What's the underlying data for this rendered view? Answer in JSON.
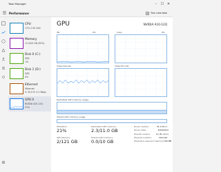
{
  "window": {
    "title": "Task Manager"
  },
  "header": {
    "section": "Performance",
    "run_new_task": "Run new task"
  },
  "sidebar": {
    "items": [
      {
        "name": "CPU",
        "sub1": "17%  2.50 GHz",
        "sub2": "",
        "color": "#117dbb"
      },
      {
        "name": "Memory",
        "sub1": "11.0/20 GB (55%)",
        "sub2": "",
        "color": "#8b12ae"
      },
      {
        "name": "Disk 0 (C:)",
        "sub1": "SSD",
        "sub2": "1%",
        "color": "#4da60c"
      },
      {
        "name": "Disk 1 (D:)",
        "sub1": "SSD",
        "sub2": "0%",
        "color": "#4da60c"
      },
      {
        "name": "Ethernet",
        "sub1": "Ethernet",
        "sub2": "S: 32.0  R: 0.1 Mbps",
        "color": "#a74f01"
      },
      {
        "name": "GPU 0",
        "sub1": "NVIDIA A10-12Q",
        "sub2": "21%",
        "color": "#1473e6"
      }
    ]
  },
  "main": {
    "title": "GPU",
    "model": "NVIDIA A10-12Q",
    "graphs": {
      "g1_left": "3D",
      "g1_right": "Copy",
      "g2_left": "Video Decode",
      "g2_right": "Video Encode",
      "dedicated": "Dedicated GPU memory usage",
      "shared": "Shared GPU memory usage",
      "g1_pct": "0%",
      "g1r_pct": "0%"
    },
    "stats": {
      "utilization_label": "Utilization",
      "utilization": "21%",
      "dedicated_label": "Dedicated GPU memory",
      "dedicated": "2.3/11.0 GB",
      "gpu_mem_label": "GPU Memory",
      "gpu_mem": "2/121 GB",
      "shared_label": "Shared GPU memory",
      "shared": "0.0/10 GB"
    },
    "properties": [
      {
        "k": "Driver version:",
        "v": "31.0.15.2..."
      },
      {
        "k": "Driver date:",
        "v": "8/18/2022"
      },
      {
        "k": "DirectX version:",
        "v": "12 (FL 12.1)"
      },
      {
        "k": "Physical location:",
        "v": "NvGraP..."
      },
      {
        "k": "Hardware reserved memory:",
        "v": "166 MB"
      }
    ]
  }
}
